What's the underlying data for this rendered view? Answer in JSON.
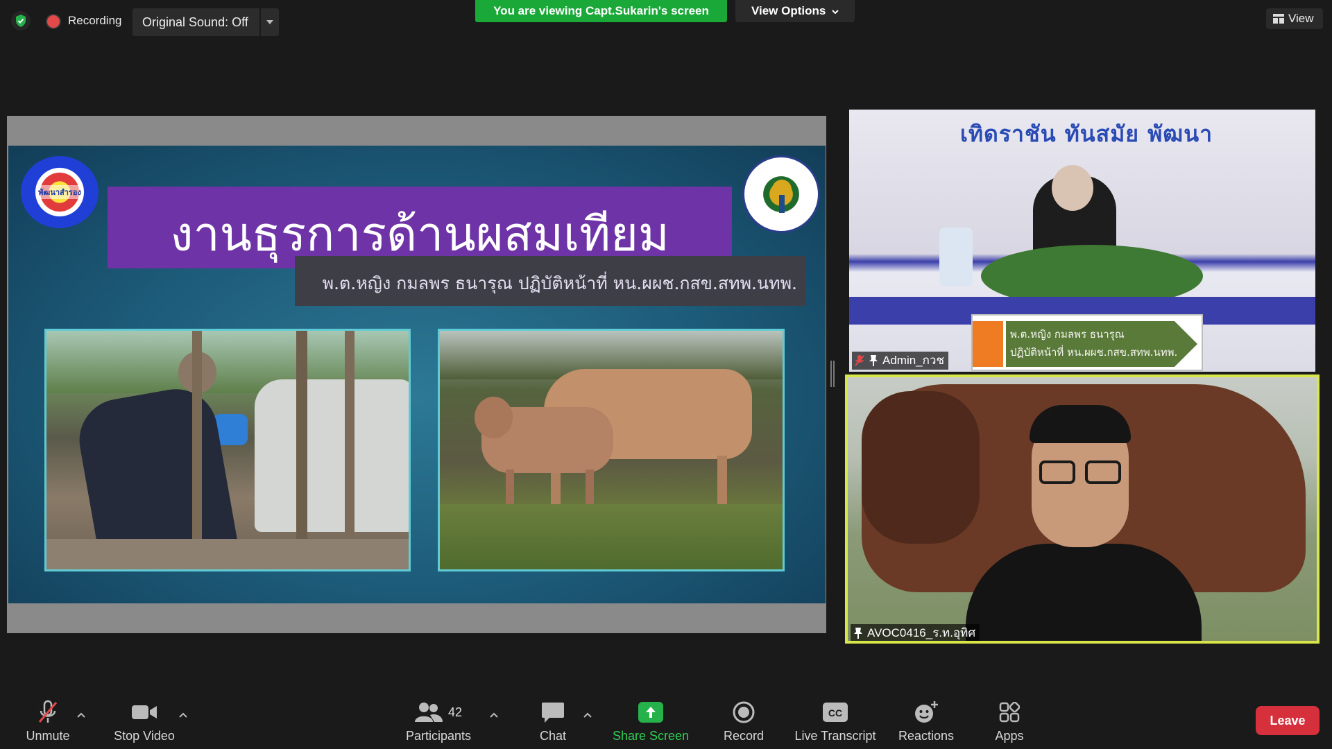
{
  "topbar": {
    "recording_label": "Recording",
    "original_sound_label": "Original Sound: Off",
    "viewing_banner": "You are viewing Capt.Sukarin's screen",
    "view_options_label": "View Options",
    "view_label": "View"
  },
  "slide": {
    "title": "งานธุรการด้านผสมเทียม",
    "subtitle": "พ.ต.หญิง กมลพร  ธนารุณ ปฏิบัติหน้าที่ หน.ผผช.กสข.สทพ.นทพ.",
    "logo_left_text": "พัฒนาสำรอง"
  },
  "video": {
    "tile1": {
      "motto": "เทิดราชัน    ทันสมัย    พัฒนา",
      "sign_line1": "พ.ต.หญิง กมลพร  ธนารุณ",
      "sign_line2": "ปฏิบัติหน้าที่ หน.ผผช.กสข.สทพ.นทพ.",
      "name": "Admin_กวช"
    },
    "tile2": {
      "name": "AVOC0416_ร.ท.อุทิศ"
    }
  },
  "toolbar": {
    "unmute": "Unmute",
    "stop_video": "Stop Video",
    "participants": "Participants",
    "participant_count": "42",
    "chat": "Chat",
    "share_screen": "Share Screen",
    "record": "Record",
    "live_transcript": "Live Transcript",
    "reactions": "Reactions",
    "apps": "Apps",
    "leave": "Leave"
  },
  "colors": {
    "banner_green": "#1aa838",
    "leave_red": "#d6303c",
    "active_speaker_border": "#d8e64a",
    "title_purple": "#6e33a6"
  },
  "icons": [
    "shield-check-icon",
    "record-dot-icon",
    "chevron-down-icon",
    "grid-view-icon",
    "mic-muted-icon",
    "video-camera-icon",
    "participants-icon",
    "chat-bubble-icon",
    "share-screen-arrow-icon",
    "record-icon",
    "cc-icon",
    "reactions-icon",
    "apps-icon",
    "pin-icon"
  ]
}
